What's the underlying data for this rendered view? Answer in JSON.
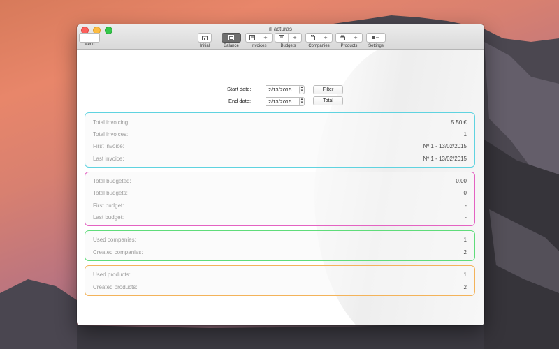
{
  "window": {
    "title": "iFacturas"
  },
  "menu": {
    "label": "Menu"
  },
  "toolbar": [
    {
      "id": "initial",
      "label": "Initial",
      "cells": 1,
      "active": false,
      "add": false
    },
    {
      "id": "balance",
      "label": "Balance",
      "cells": 1,
      "active": true,
      "add": false
    },
    {
      "id": "invoices",
      "label": "Invoices",
      "cells": 2,
      "active": false,
      "add": true
    },
    {
      "id": "budgets",
      "label": "Budgets",
      "cells": 2,
      "active": false,
      "add": true
    },
    {
      "id": "companies",
      "label": "Companies",
      "cells": 2,
      "active": false,
      "add": true
    },
    {
      "id": "products",
      "label": "Products",
      "cells": 2,
      "active": false,
      "add": true
    },
    {
      "id": "settings",
      "label": "Settings",
      "cells": 1,
      "active": false,
      "add": false
    }
  ],
  "filters": {
    "start_label": "Start date:",
    "start_value": "2/13/2015",
    "end_label": "End date:",
    "end_value": "2/13/2015",
    "filter_button": "Filter",
    "total_button": "Total"
  },
  "panels": {
    "invoicing": {
      "color": "#5fd3e0",
      "rows": [
        {
          "label": "Total invoicing:",
          "value": "5.50 €"
        },
        {
          "label": "Total invoices:",
          "value": "1"
        },
        {
          "label": "First invoice:",
          "value": "Nº 1 - 13/02/2015"
        },
        {
          "label": "Last invoice:",
          "value": "Nº 1 - 13/02/2015"
        }
      ]
    },
    "budgets": {
      "color": "#e462c2",
      "rows": [
        {
          "label": "Total budgeted:",
          "value": "0.00"
        },
        {
          "label": "Total budgets:",
          "value": "0"
        },
        {
          "label": "First budget:",
          "value": "-"
        },
        {
          "label": "Last budget:",
          "value": "-"
        }
      ]
    },
    "companies": {
      "color": "#5fdc7a",
      "rows": [
        {
          "label": "Used companies:",
          "value": "1"
        },
        {
          "label": "Created companies:",
          "value": "2"
        }
      ]
    },
    "products": {
      "color": "#f3b35a",
      "rows": [
        {
          "label": "Used products:",
          "value": "1"
        },
        {
          "label": "Created products:",
          "value": "2"
        }
      ]
    }
  }
}
